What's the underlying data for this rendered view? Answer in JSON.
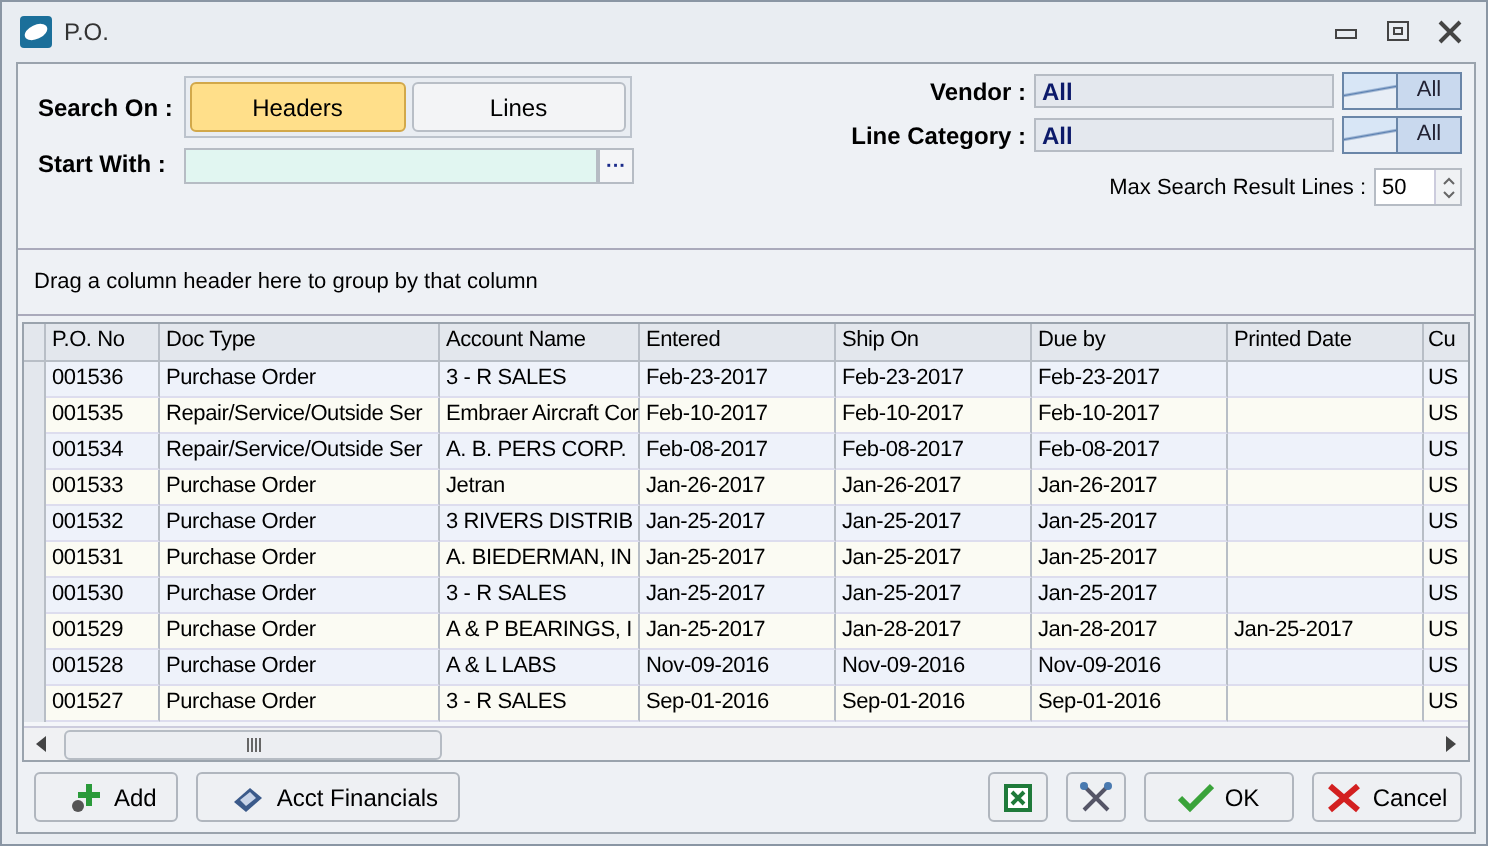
{
  "window": {
    "title": "P.O."
  },
  "search_on": {
    "label": "Search On :",
    "options": [
      {
        "label": "Headers",
        "selected": true
      },
      {
        "label": "Lines",
        "selected": false
      }
    ]
  },
  "start_with": {
    "label": "Start With :",
    "button": "···"
  },
  "filters": [
    {
      "label": "Vendor :",
      "value": "All",
      "button": "All"
    },
    {
      "label": "Line Category :",
      "value": "All",
      "button": "All"
    }
  ],
  "max_lines": {
    "label": "Max Search Result Lines :",
    "value": "50"
  },
  "group_hint": "Drag a column header here to group by that column",
  "table": {
    "columns": [
      "P.O. No",
      "Doc Type",
      "Account Name",
      "Entered",
      "Ship On",
      "Due by",
      "Printed Date",
      "Cu"
    ],
    "rows": [
      [
        "001536",
        "Purchase Order",
        "3 - R SALES",
        "Feb-23-2017",
        "Feb-23-2017",
        "Feb-23-2017",
        "",
        "US"
      ],
      [
        "001535",
        "Repair/Service/Outside Ser",
        "Embraer Aircraft Cor",
        "Feb-10-2017",
        "Feb-10-2017",
        "Feb-10-2017",
        "",
        "US"
      ],
      [
        "001534",
        "Repair/Service/Outside Ser",
        "A. B. PERS CORP.",
        "Feb-08-2017",
        "Feb-08-2017",
        "Feb-08-2017",
        "",
        "US"
      ],
      [
        "001533",
        "Purchase Order",
        "Jetran",
        "Jan-26-2017",
        "Jan-26-2017",
        "Jan-26-2017",
        "",
        "US"
      ],
      [
        "001532",
        "Purchase Order",
        "3 RIVERS DISTRIB",
        "Jan-25-2017",
        "Jan-25-2017",
        "Jan-25-2017",
        "",
        "US"
      ],
      [
        "001531",
        "Purchase Order",
        "A. BIEDERMAN, IN",
        "Jan-25-2017",
        "Jan-25-2017",
        "Jan-25-2017",
        "",
        "US"
      ],
      [
        "001530",
        "Purchase Order",
        "3 - R SALES",
        "Jan-25-2017",
        "Jan-25-2017",
        "Jan-25-2017",
        "",
        "US"
      ],
      [
        "001529",
        "Purchase Order",
        "A & P BEARINGS, I",
        "Jan-25-2017",
        "Jan-28-2017",
        "Jan-28-2017",
        "Jan-25-2017",
        "US"
      ],
      [
        "001528",
        "Purchase Order",
        "A & L LABS",
        "Nov-09-2016",
        "Nov-09-2016",
        "Nov-09-2016",
        "",
        "US"
      ],
      [
        "001527",
        "Purchase Order",
        "3 - R SALES",
        "Sep-01-2016",
        "Sep-01-2016",
        "Sep-01-2016",
        "",
        "US"
      ]
    ]
  },
  "buttons_left": [
    {
      "kind": "add",
      "label": "Add"
    },
    {
      "kind": "financials",
      "label": "Acct Financials"
    }
  ],
  "buttons_right": [
    {
      "kind": "excel"
    },
    {
      "kind": "tools"
    },
    {
      "kind": "ok",
      "label": "OK"
    },
    {
      "kind": "cancel",
      "label": "Cancel"
    }
  ]
}
